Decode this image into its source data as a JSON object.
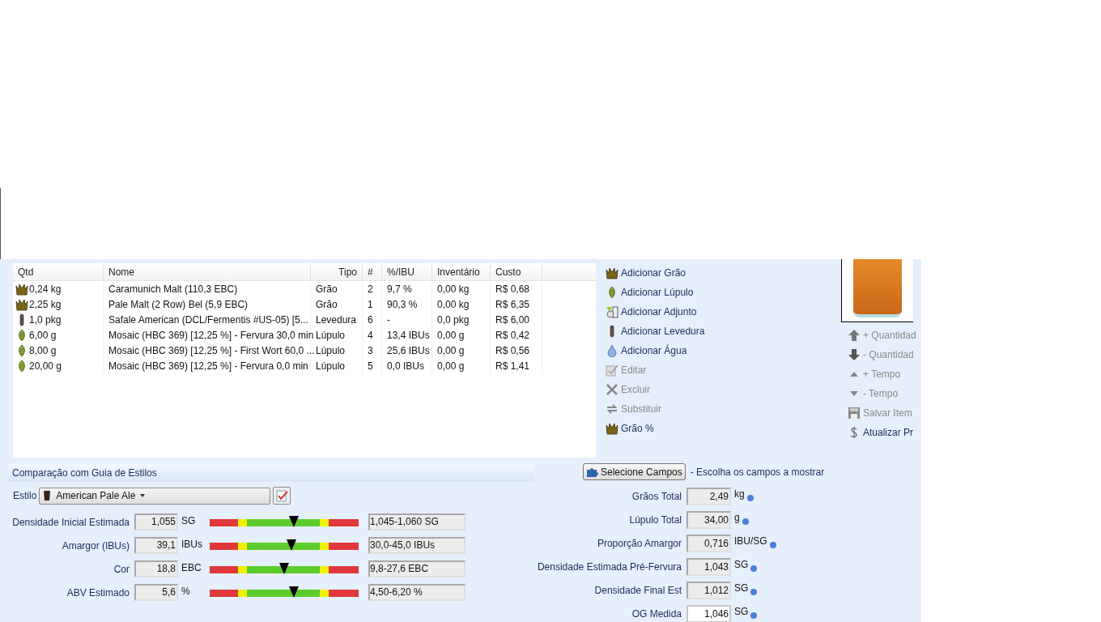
{
  "ingredients": {
    "columns": [
      "Qtd",
      "Nome",
      "Tipo",
      "#",
      "%/IBU",
      "Inventário",
      "Custo"
    ],
    "rows": [
      {
        "kind": "grain",
        "qty": "0,24 kg",
        "name": "Caramunich Malt (110,3 EBC)",
        "type": "Grão",
        "num": "2",
        "pct_ibu": "9,7 %",
        "inventory": "0,00 kg",
        "cost": "R$ 0,68"
      },
      {
        "kind": "grain",
        "qty": "2,25 kg",
        "name": "Pale Malt (2 Row) Bel (5,9 EBC)",
        "type": "Grão",
        "num": "1",
        "pct_ibu": "90,3 %",
        "inventory": "0,00 kg",
        "cost": "R$ 6,35"
      },
      {
        "kind": "yeast",
        "qty": "1,0 pkg",
        "name": "Safale American  (DCL/Fermentis #US-05) [5...",
        "type": "Levedura",
        "num": "6",
        "pct_ibu": "-",
        "inventory": "0,0 pkg",
        "cost": "R$ 6,00"
      },
      {
        "kind": "hop",
        "qty": "6,00 g",
        "name": "Mosaic (HBC 369) [12,25 %] - Fervura 30,0 min",
        "type": "Lúpulo",
        "num": "4",
        "pct_ibu": "13,4 IBUs",
        "inventory": "0,00 g",
        "cost": "R$ 0,42"
      },
      {
        "kind": "hop",
        "qty": "8,00 g",
        "name": "Mosaic (HBC 369) [12,25 %] - First Wort 60,0 ...",
        "type": "Lúpulo",
        "num": "3",
        "pct_ibu": "25,6 IBUs",
        "inventory": "0,00 g",
        "cost": "R$ 0,56"
      },
      {
        "kind": "hop",
        "qty": "20,00 g",
        "name": "Mosaic (HBC 369) [12,25 %] - Fervura 0,0 min",
        "type": "Lúpulo",
        "num": "5",
        "pct_ibu": "0,0 IBUs",
        "inventory": "0,00 g",
        "cost": "R$ 1,41"
      }
    ]
  },
  "actions": [
    {
      "kind": "grain",
      "label": "Adicionar Grão",
      "disabled": false
    },
    {
      "kind": "hop",
      "label": "Adicionar Lúpulo",
      "disabled": false
    },
    {
      "kind": "adjunct",
      "label": "Adicionar Adjunto",
      "disabled": false
    },
    {
      "kind": "yeast",
      "label": "Adicionar Levedura",
      "disabled": false
    },
    {
      "kind": "water",
      "label": "Adicionar Água",
      "disabled": false
    },
    {
      "kind": "edit",
      "label": "Editar",
      "disabled": true
    },
    {
      "kind": "delete",
      "label": "Excluir",
      "disabled": true
    },
    {
      "kind": "swap",
      "label": "Substituir",
      "disabled": true
    },
    {
      "kind": "grain",
      "label": "Grão %",
      "disabled": false
    }
  ],
  "item_actions": [
    {
      "kind": "up",
      "label": "+ Quantidad",
      "disabled": true
    },
    {
      "kind": "down",
      "label": "- Quantidad",
      "disabled": true
    },
    {
      "kind": "up-small",
      "label": "+ Tempo",
      "disabled": true
    },
    {
      "kind": "down-small",
      "label": "- Tempo",
      "disabled": true
    },
    {
      "kind": "save",
      "label": "Salvar Item",
      "disabled": true
    },
    {
      "kind": "price",
      "label": "Atualizar Pr",
      "disabled": false
    }
  ],
  "style_guide": {
    "title": "Comparação com Guia de Estilos",
    "style_label": "Estilo",
    "style_value": "American Pale Ale",
    "rows": [
      {
        "label": "Densidade Inicial Estimada",
        "value": "1,055",
        "unit": "SG",
        "level": 0.565,
        "range": "1,045-1,060 SG"
      },
      {
        "label": "Amargor (IBUs)",
        "value": "39,1",
        "unit": "IBUs",
        "level": 0.55,
        "range": "30,0-45,0 IBUs"
      },
      {
        "label": "Cor",
        "value": "18,8",
        "unit": "EBC",
        "level": 0.5,
        "range": "9,8-27,6 EBC"
      },
      {
        "label": "ABV Estimado",
        "value": "5,6",
        "unit": "%",
        "level": 0.565,
        "range": "4,50-6,20 %"
      }
    ]
  },
  "fields_panel": {
    "button": "Selecione Campos",
    "hint": "- Escolha os campos a mostrar",
    "fields": [
      {
        "label": "Grãos Total",
        "value": "2,49",
        "unit": "kg",
        "editable": false
      },
      {
        "label": "Lúpulo Total",
        "value": "34,00",
        "unit": "g",
        "editable": false
      },
      {
        "label": "Proporção Amargor",
        "value": "0,716",
        "unit": "IBU/SG",
        "editable": false
      },
      {
        "label": "Densidade Estimada Pré-Fervura",
        "value": "1,043",
        "unit": "SG",
        "editable": false
      },
      {
        "label": "Densidade Final Est",
        "value": "1,012",
        "unit": "SG",
        "editable": false
      },
      {
        "label": "OG Medida",
        "value": "1,046",
        "unit": "SG",
        "editable": true
      }
    ]
  }
}
